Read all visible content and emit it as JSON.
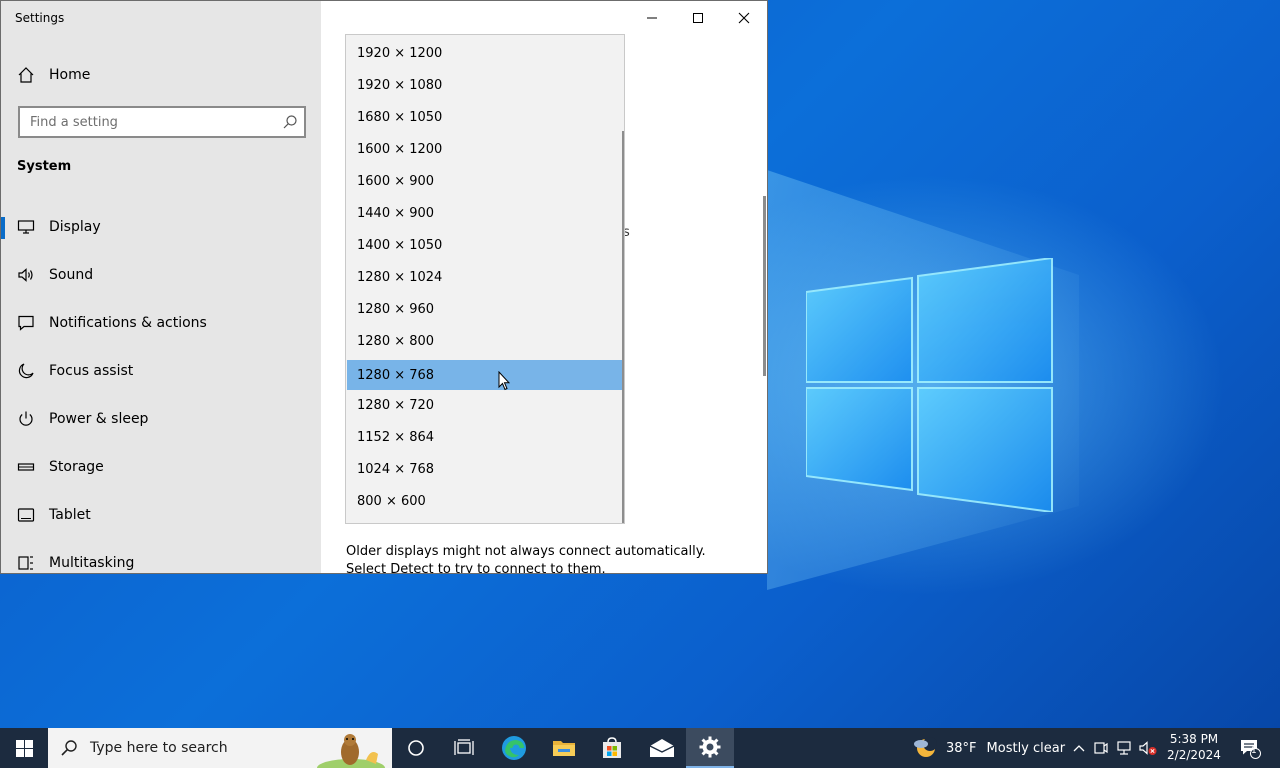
{
  "window": {
    "title": "Settings"
  },
  "sidebar": {
    "home_label": "Home",
    "search_placeholder": "Find a setting",
    "section_label": "System",
    "items": [
      {
        "label": "Display",
        "icon": "monitor-icon",
        "active": true
      },
      {
        "label": "Sound",
        "icon": "speaker-icon"
      },
      {
        "label": "Notifications & actions",
        "icon": "message-icon"
      },
      {
        "label": "Focus assist",
        "icon": "moon-icon"
      },
      {
        "label": "Power & sleep",
        "icon": "power-icon"
      },
      {
        "label": "Storage",
        "icon": "storage-icon"
      },
      {
        "label": "Tablet",
        "icon": "tablet-icon"
      },
      {
        "label": "Multitasking",
        "icon": "multitasking-icon"
      }
    ]
  },
  "dropdown": {
    "options": [
      "1920 × 1200",
      "1920 × 1080",
      "1680 × 1050",
      "1600 × 1200",
      "1600 × 900",
      "1440 × 900",
      "1400 × 1050",
      "1280 × 1024",
      "1280 × 960",
      "1280 × 800",
      "1280 × 768",
      "1280 × 720",
      "1152 × 864",
      "1024 × 768",
      "800 × 600"
    ],
    "selected": "1280 × 768"
  },
  "content": {
    "helper_text": "Older displays might not always connect automatically. Select Detect to try to connect to them.",
    "background_fragment": "s"
  },
  "taskbar": {
    "search_placeholder": "Type here to search",
    "weather": {
      "temp": "38°F",
      "condition": "Mostly clear"
    },
    "time": "5:38 PM",
    "date": "2/2/2024",
    "notification_count": "1"
  },
  "colors": {
    "accent": "#0a6cc8",
    "selection": "#78b4e8",
    "taskbar": "#1c2b3f"
  }
}
